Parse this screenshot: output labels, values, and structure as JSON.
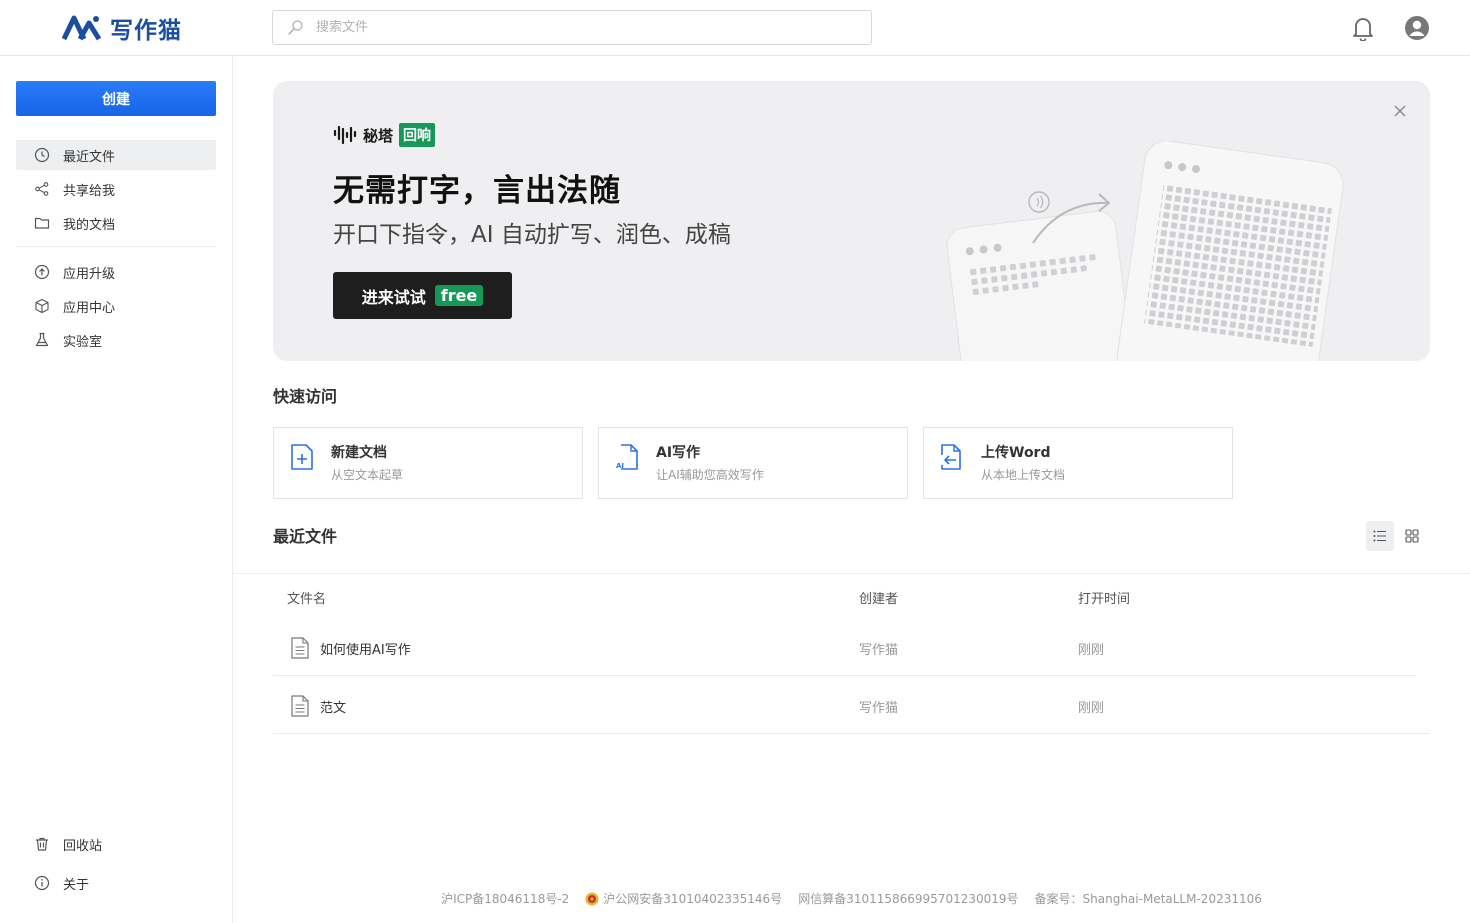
{
  "header": {
    "brand": "写作猫",
    "search_placeholder": "搜索文件"
  },
  "sidebar": {
    "create_label": "创建",
    "items": [
      {
        "label": "最近文件"
      },
      {
        "label": "共享给我"
      },
      {
        "label": "我的文档"
      },
      {
        "label": "应用升级"
      },
      {
        "label": "应用中心"
      },
      {
        "label": "实验室"
      },
      {
        "label": "回收站"
      },
      {
        "label": "关于"
      }
    ]
  },
  "banner": {
    "brand_name": "秘塔",
    "brand_tag": "回响",
    "title": "无需打字，言出法随",
    "subtitle": "开口下指令，AI 自动扩写、润色、成稿",
    "cta_label": "进来试试",
    "cta_badge": "free"
  },
  "quick_access": {
    "title": "快速访问",
    "cards": [
      {
        "title": "新建文档",
        "desc": "从空文本起草",
        "icon": "new-doc-icon"
      },
      {
        "title": "AI写作",
        "desc": "让AI辅助您高效写作",
        "icon": "ai-doc-icon"
      },
      {
        "title": "上传Word",
        "desc": "从本地上传文档",
        "icon": "upload-doc-icon"
      }
    ]
  },
  "recent": {
    "title": "最近文件",
    "columns": [
      "文件名",
      "创建者",
      "打开时间"
    ],
    "rows": [
      {
        "name": "如何使用AI写作",
        "creator": "写作猫",
        "time": "刚刚"
      },
      {
        "name": "范文",
        "creator": "写作猫",
        "time": "刚刚"
      }
    ]
  },
  "footer": {
    "icp": "沪ICP备18046118号-2",
    "police": "沪公网安备31010402335146号",
    "algo": "网信算备310115866995701230019号",
    "record": "备案号：Shanghai-MetaLLM-20231106"
  },
  "colors": {
    "primary": "#1764e8",
    "brand": "#1c4ea0",
    "green": "#179857"
  }
}
